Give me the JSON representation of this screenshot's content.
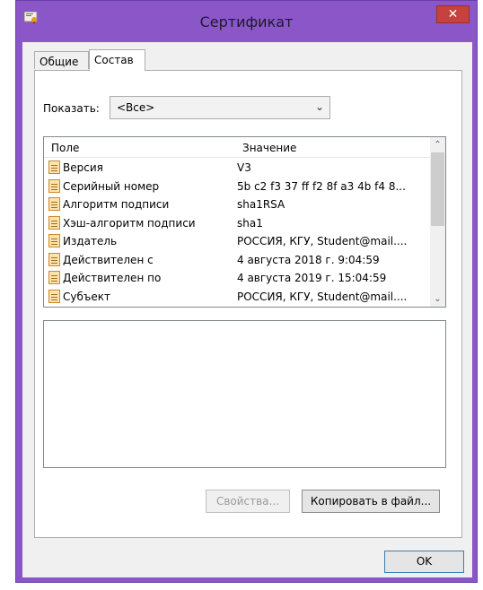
{
  "window": {
    "title": "Сертификат",
    "close_label": "✕"
  },
  "tabs": [
    {
      "label": "Общие",
      "active": false
    },
    {
      "label": "Состав",
      "active": true
    }
  ],
  "show": {
    "label": "Показать:",
    "selected": "<Все>"
  },
  "list": {
    "columns": [
      "Поле",
      "Значение"
    ],
    "rows": [
      {
        "field": "Версия",
        "value": "V3"
      },
      {
        "field": "Серийный номер",
        "value": "5b c2 f3 37 ff f2 8f a3 4b f4 8..."
      },
      {
        "field": "Алгоритм подписи",
        "value": "sha1RSA"
      },
      {
        "field": "Хэш-алгоритм подписи",
        "value": "sha1"
      },
      {
        "field": "Издатель",
        "value": "РОССИЯ, КГУ, Student@mail...."
      },
      {
        "field": "Действителен с",
        "value": "4 августа 2018 г. 9:04:59"
      },
      {
        "field": "Действителен по",
        "value": "4 августа 2019 г. 15:04:59"
      },
      {
        "field": "Субъект",
        "value": "РОССИЯ, КГУ, Student@mail...."
      }
    ]
  },
  "buttons": {
    "properties": "Свойства...",
    "copy_to_file": "Копировать в файл...",
    "ok": "OK"
  }
}
